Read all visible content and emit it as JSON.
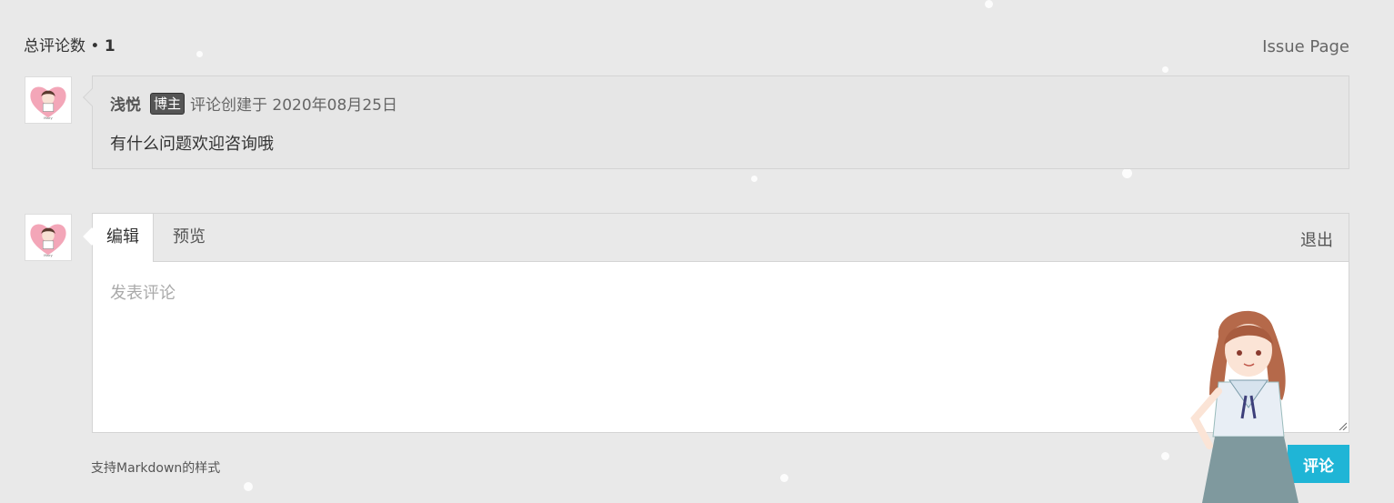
{
  "header": {
    "count_label": "总评论数 •",
    "count_value": "1",
    "issue_link": "Issue Page"
  },
  "comments": [
    {
      "author": "浅悦",
      "badge": "博主",
      "created": "评论创建于 2020年08月25日",
      "body": "有什么问题欢迎咨询哦"
    }
  ],
  "editor": {
    "tab_edit": "编辑",
    "tab_preview": "预览",
    "logout": "退出",
    "placeholder": "发表评论"
  },
  "footer": {
    "markdown_tip": "支持Markdown的样式",
    "submit": "评论"
  },
  "colors": {
    "background": "#e9e9e9",
    "submit_button": "#1fb5d6",
    "badge": "#555555"
  },
  "icons": {
    "avatar": "heart-portrait-avatar",
    "mascot": "anime-girl-mascot"
  }
}
